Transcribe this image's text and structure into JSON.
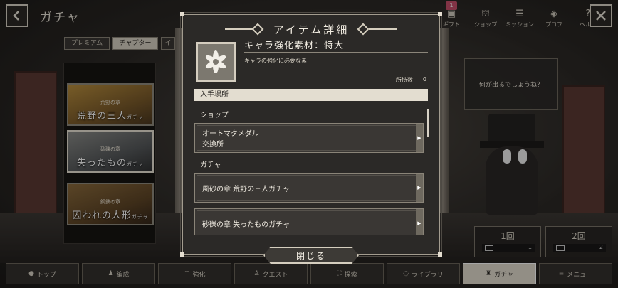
{
  "topbar": {
    "title": "ガチャ",
    "nav": [
      {
        "label": "ギフト",
        "icon": "gift-icon",
        "glyph": "▣",
        "badge": "1"
      },
      {
        "label": "ショップ",
        "icon": "shop-icon",
        "glyph": "⛫"
      },
      {
        "label": "ミッション",
        "icon": "mission-icon",
        "glyph": "☰"
      },
      {
        "label": "プロフ",
        "icon": "profile-icon",
        "glyph": "◈"
      },
      {
        "label": "ヘルプ",
        "icon": "help-icon",
        "glyph": "?"
      }
    ]
  },
  "gacha": {
    "tabs": [
      "プレミアム",
      "チャプター",
      "イ"
    ],
    "banners": [
      {
        "sub": "荒野の章",
        "name": "荒野の三人",
        "suffix": "ガチャ"
      },
      {
        "sub": "砂礫の章",
        "name": "失ったもの",
        "suffix": "ガチャ"
      },
      {
        "sub": "鋼鉄の章",
        "name": "囚われの人形",
        "suffix": "ガチャ"
      }
    ]
  },
  "speech": "何が出るでしょうね？",
  "pulls": [
    {
      "label": "1回",
      "count": "1"
    },
    {
      "label": "2回",
      "count": "2"
    }
  ],
  "bottom_nav": [
    {
      "label": "トップ",
      "icon": "home-icon",
      "glyph": "●"
    },
    {
      "label": "編成",
      "icon": "formation-icon",
      "glyph": "♟"
    },
    {
      "label": "強化",
      "icon": "enhance-icon",
      "glyph": "⚚"
    },
    {
      "label": "クエスト",
      "icon": "quest-icon",
      "glyph": "♙"
    },
    {
      "label": "探索",
      "icon": "explore-icon",
      "glyph": "⛶"
    },
    {
      "label": "ライブラリ",
      "icon": "library-icon",
      "glyph": "◌"
    },
    {
      "label": "ガチャ",
      "icon": "gacha-icon",
      "glyph": "♜",
      "active": true
    },
    {
      "label": "メニュー",
      "icon": "menu-icon",
      "glyph": "≡"
    }
  ],
  "modal": {
    "title": "アイテム詳細",
    "item_name": "キャラ強化素材：特大",
    "item_desc": "キャラの強化に必要な素",
    "owned_label": "所持数",
    "owned_value": "0",
    "source_header": "入手場所",
    "categories": [
      {
        "label": "ショップ",
        "rows": [
          {
            "line1": "オートマタメダル",
            "line2": "交換所"
          }
        ]
      },
      {
        "label": "ガチャ",
        "rows": [
          {
            "line1": "風砂の章 荒野の三人ガチャ"
          },
          {
            "line1": "砂礫の章 失ったものガチャ"
          }
        ]
      }
    ],
    "close_label": "閉じる"
  },
  "colors": {
    "panel": "#2b2927",
    "accent_light": "#e3ddd0",
    "badge": "#c64f6a",
    "active_nav": "#e1dbcd"
  }
}
